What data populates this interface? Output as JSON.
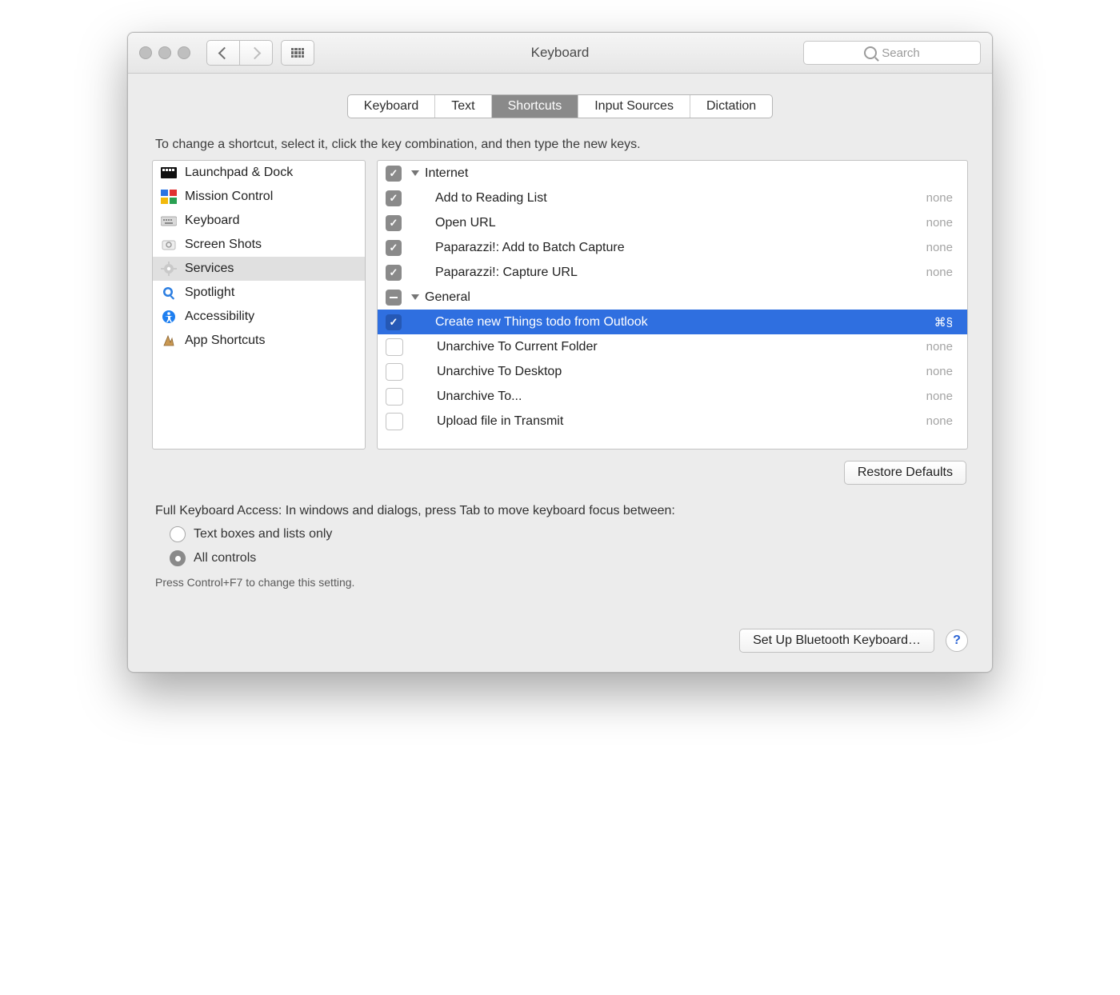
{
  "window": {
    "title": "Keyboard"
  },
  "toolbar": {
    "search_placeholder": "Search"
  },
  "tabs": [
    "Keyboard",
    "Text",
    "Shortcuts",
    "Input Sources",
    "Dictation"
  ],
  "active_tab": 2,
  "hint": "To change a shortcut, select it, click the key combination, and then type the new keys.",
  "categories": [
    {
      "label": "Launchpad & Dock",
      "icon": "launchpad"
    },
    {
      "label": "Mission Control",
      "icon": "mission"
    },
    {
      "label": "Keyboard",
      "icon": "keyboard"
    },
    {
      "label": "Screen Shots",
      "icon": "screenshot"
    },
    {
      "label": "Services",
      "icon": "services",
      "selected": true
    },
    {
      "label": "Spotlight",
      "icon": "spotlight"
    },
    {
      "label": "Accessibility",
      "icon": "accessibility"
    },
    {
      "label": "App Shortcuts",
      "icon": "appshortcuts"
    }
  ],
  "groups": [
    {
      "header": "Internet",
      "check": "on",
      "items": [
        {
          "label": "Add to Reading List",
          "check": "on",
          "shortcut": "none"
        },
        {
          "label": "Open URL",
          "check": "on",
          "shortcut": "none"
        },
        {
          "label": "Paparazzi!: Add to Batch Capture",
          "check": "on",
          "shortcut": "none"
        },
        {
          "label": "Paparazzi!: Capture URL",
          "check": "on",
          "shortcut": "none"
        }
      ]
    },
    {
      "header": "General",
      "check": "mix",
      "items": [
        {
          "label": "Create new Things todo from Outlook",
          "check": "on",
          "shortcut": "⌘§",
          "selected": true
        },
        {
          "label": "Unarchive To Current Folder",
          "check": "off",
          "shortcut": "none"
        },
        {
          "label": "Unarchive To Desktop",
          "check": "off",
          "shortcut": "none"
        },
        {
          "label": "Unarchive To...",
          "check": "off",
          "shortcut": "none"
        },
        {
          "label": "Upload file in Transmit",
          "check": "off",
          "shortcut": "none"
        }
      ]
    }
  ],
  "restore_button": "Restore Defaults",
  "kba_label": "Full Keyboard Access: In windows and dialogs, press Tab to move keyboard focus between:",
  "kba_options": [
    {
      "label": "Text boxes and lists only",
      "on": false
    },
    {
      "label": "All controls",
      "on": true
    }
  ],
  "kba_hint": "Press Control+F7 to change this setting.",
  "bluetooth_button": "Set Up Bluetooth Keyboard…",
  "help_label": "?"
}
